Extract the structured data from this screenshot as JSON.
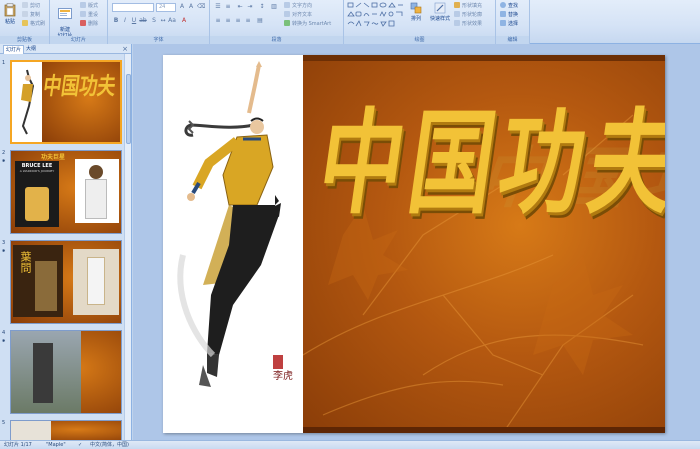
{
  "ribbon": {
    "clipboard": {
      "paste": "粘贴",
      "cut": "剪切",
      "copy": "复制",
      "format_painter": "格式刷",
      "label": "剪贴板"
    },
    "slides": {
      "new_slide": "新建\n幻灯片",
      "layout": "版式",
      "reset": "重设",
      "delete": "删除",
      "label": "幻灯片"
    },
    "font": {
      "font_name": "",
      "font_size": "24",
      "label": "字体"
    },
    "paragraph": {
      "text_direction": "文字方向",
      "align_text": "对齐文本",
      "smartart": "转换为 SmartArt",
      "label": "段落"
    },
    "drawing": {
      "arrange": "排列",
      "quick_styles": "快速样式",
      "shape_fill": "形状填充",
      "shape_outline": "形状轮廓",
      "shape_effects": "形状效果",
      "label": "绘图"
    },
    "editing": {
      "find": "查找",
      "replace": "替换",
      "select": "选择",
      "label": "编辑"
    }
  },
  "panel": {
    "tabs": {
      "slides": "幻灯片",
      "outline": "大纲"
    },
    "close": "×",
    "thumbs": [
      {
        "num": "1",
        "title": "中国功夫"
      },
      {
        "num": "2",
        "title": "功夫巨星",
        "text": "BRUCE LEE",
        "sub": "A WARRIOR'S JOURNEY"
      },
      {
        "num": "3",
        "title": "",
        "text": "葉問"
      },
      {
        "num": "4",
        "title": ""
      },
      {
        "num": "5",
        "title": ""
      }
    ]
  },
  "slide": {
    "title": "中国功夫",
    "signature": "李虎"
  },
  "statusbar": {
    "slide_info": "幻灯片 1/17",
    "theme": "\"Maple\"",
    "language": "中文(简体，中国)"
  },
  "colors": {
    "slide_orange": "#b45810",
    "title_gold": "#f2c237",
    "thumb_selected": "#f5a623"
  }
}
